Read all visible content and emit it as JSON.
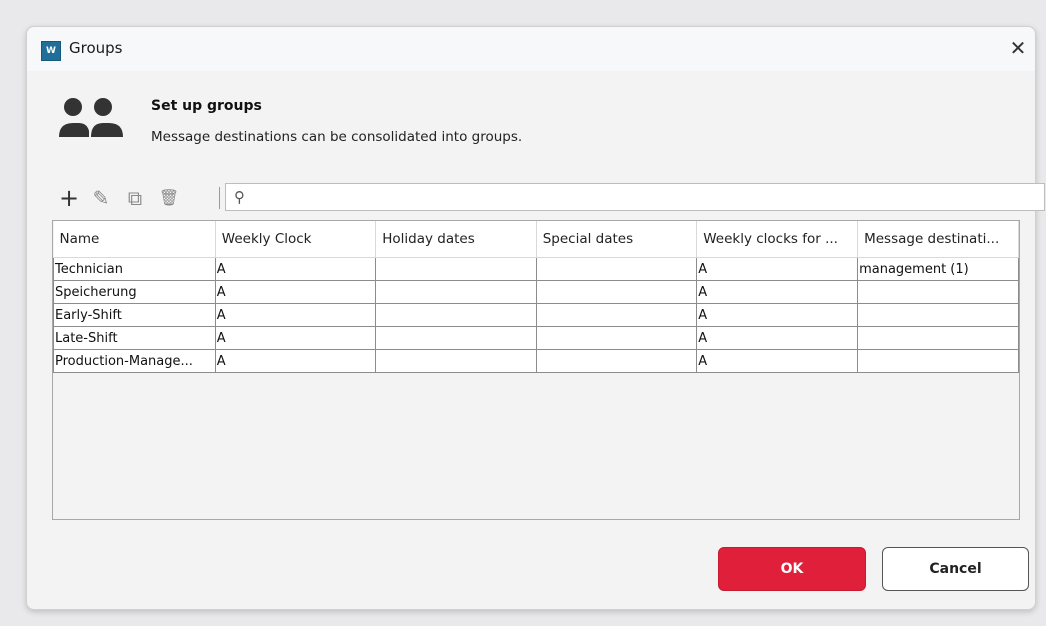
{
  "window": {
    "title": "Groups",
    "app_icon_text": "W",
    "close_glyph": "✕"
  },
  "header": {
    "title": "Set up groups",
    "subtitle": "Message destinations can be consolidated into groups."
  },
  "toolbar": {
    "add_glyph": "+",
    "edit_glyph": "✎",
    "copy_glyph": "⧉",
    "delete_glyph": "🗑",
    "search": {
      "value": "",
      "placeholder": ""
    }
  },
  "table": {
    "columns": [
      "Name",
      "Weekly Clock",
      "Holiday dates",
      "Special dates",
      "Weekly clocks for ...",
      "Message destinati..."
    ],
    "rows": [
      [
        "Technician",
        "A",
        "",
        "",
        "A",
        "management (1)"
      ],
      [
        "Speicherung",
        "A",
        "",
        "",
        "A",
        ""
      ],
      [
        "Early-Shift",
        "A",
        "",
        "",
        "A",
        ""
      ],
      [
        "Late-Shift",
        "A",
        "",
        "",
        "A",
        ""
      ],
      [
        "Production-Manage...",
        "A",
        "",
        "",
        "A",
        ""
      ]
    ]
  },
  "buttons": {
    "ok": "OK",
    "cancel": "Cancel"
  },
  "colors": {
    "accent_ok": "#e01f3a",
    "app_icon": "#1f6f99"
  }
}
